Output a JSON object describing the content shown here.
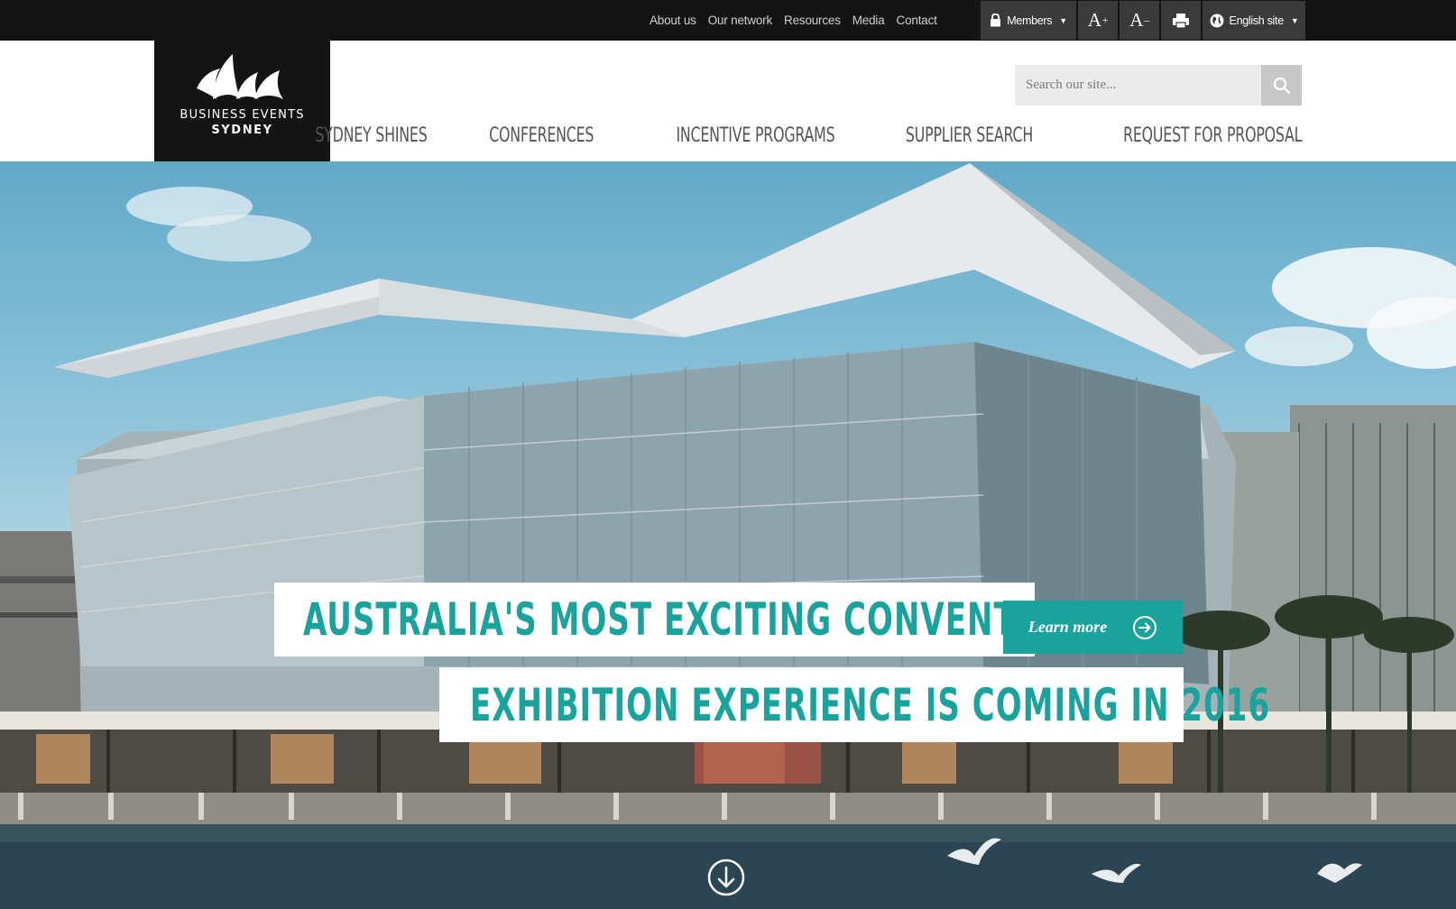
{
  "utility": {
    "links": [
      "About us",
      "Our network",
      "Resources",
      "Media",
      "Contact"
    ],
    "members_label": "Members",
    "font_increase": "A",
    "font_decrease": "A",
    "language_label": "English site"
  },
  "logo": {
    "line1": "BUSINESS EVENTS",
    "line2": "SYDNEY"
  },
  "search": {
    "placeholder": "Search our site..."
  },
  "nav": {
    "items": [
      "SYDNEY SHINES",
      "CONFERENCES",
      "INCENTIVE PROGRAMS",
      "SUPPLIER SEARCH",
      "REQUEST FOR PROPOSAL"
    ]
  },
  "hero": {
    "headline_line1": "AUSTRALIA'S MOST EXCITING CONVENTION &",
    "headline_line2": "EXHIBITION EXPERIENCE IS COMING IN 2016",
    "cta_label": "Learn more"
  },
  "colors": {
    "accent": "#1aa39c",
    "topbar": "#141414",
    "tool_bg": "#3a3a3a"
  }
}
